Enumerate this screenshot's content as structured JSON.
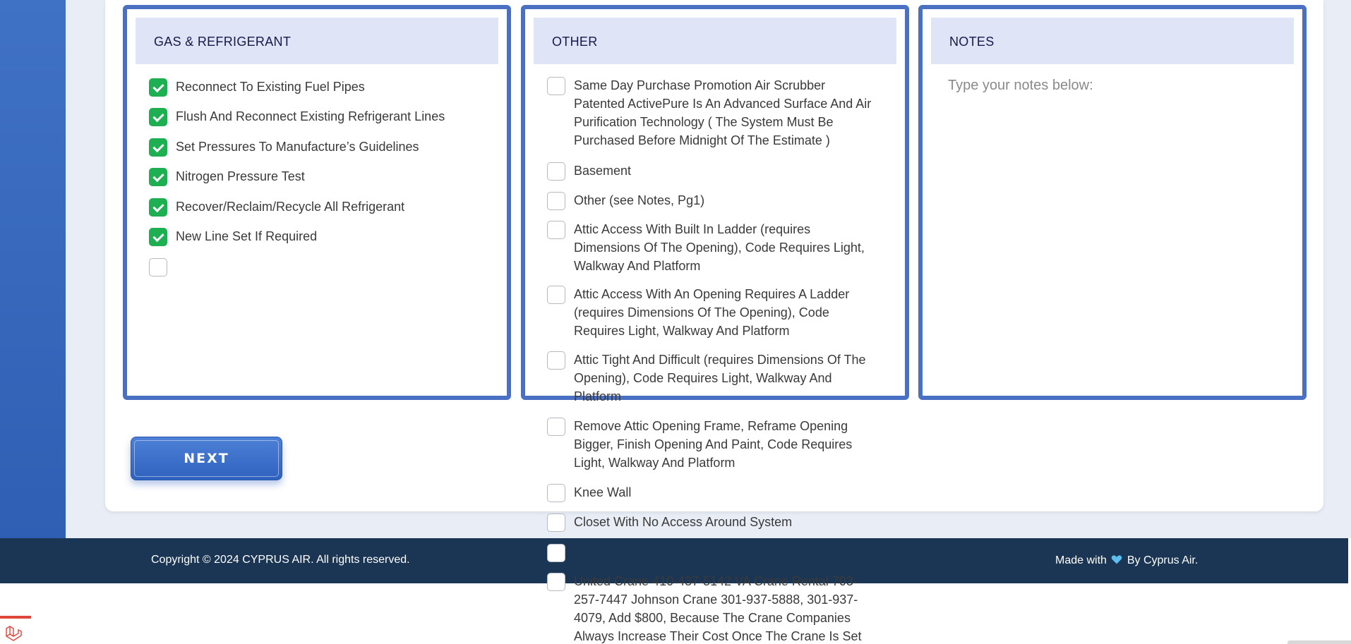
{
  "gas_refrigerant": {
    "title": "GAS & REFRIGERANT",
    "items": [
      {
        "label": "Reconnect To Existing Fuel Pipes",
        "checked": true
      },
      {
        "label": "Flush And Reconnect Existing Refrigerant Lines",
        "checked": true
      },
      {
        "label": "Set Pressures To Manufacture’s Guidelines",
        "checked": true
      },
      {
        "label": "Nitrogen Pressure Test",
        "checked": true
      },
      {
        "label": "Recover/Reclaim/Recycle All Refrigerant",
        "checked": true
      },
      {
        "label": "New Line Set If Required",
        "checked": true
      },
      {
        "label": "",
        "checked": false
      }
    ]
  },
  "other": {
    "title": "OTHER",
    "items": [
      {
        "label": "Same Day Purchase Promotion Air Scrubber Patented ActivePure Is An Advanced Surface And Air Purification Technology ( The System Must Be Purchased Before Midnight Of The Estimate )",
        "checked": false
      },
      {
        "label": "Basement",
        "checked": false
      },
      {
        "label": "Other (see Notes, Pg1)",
        "checked": false
      },
      {
        "label": "Attic Access With Built In Ladder (requires Dimensions Of The Opening), Code Requires Light, Walkway And Platform",
        "checked": false
      },
      {
        "label": "Attic Access With An Opening Requires A Ladder (requires Dimensions Of The Opening), Code Requires Light, Walkway And Platform",
        "checked": false
      },
      {
        "label": "Attic Tight And Difficult (requires Dimensions Of The Opening), Code Requires Light, Walkway And Platform",
        "checked": false
      },
      {
        "label": "Remove Attic Opening Frame, Reframe Opening Bigger, Finish Opening And Paint, Code Requires Light, Walkway And Platform",
        "checked": false
      },
      {
        "label": "Knee Wall",
        "checked": false
      },
      {
        "label": "Closet With No Access Around System",
        "checked": false
      },
      {
        "label": "",
        "checked": false
      },
      {
        "label": "United Crane 410-437-5142 VA Crane Rental 703-257-7447 Johnson Crane 301-937-5888, 301-937-4079, Add $800, Because The Crane Companies Always Increase Their Cost Once The Crane Is Set",
        "checked": false
      }
    ]
  },
  "notes": {
    "title": "NOTES",
    "placeholder": "Type your notes below:"
  },
  "next_label": "NEXT",
  "footer": {
    "copyright": "Copyright © 2024 CYPRUS AIR. All rights reserved.",
    "made_prefix": "Made with",
    "made_suffix": "By Cyprus Air."
  }
}
